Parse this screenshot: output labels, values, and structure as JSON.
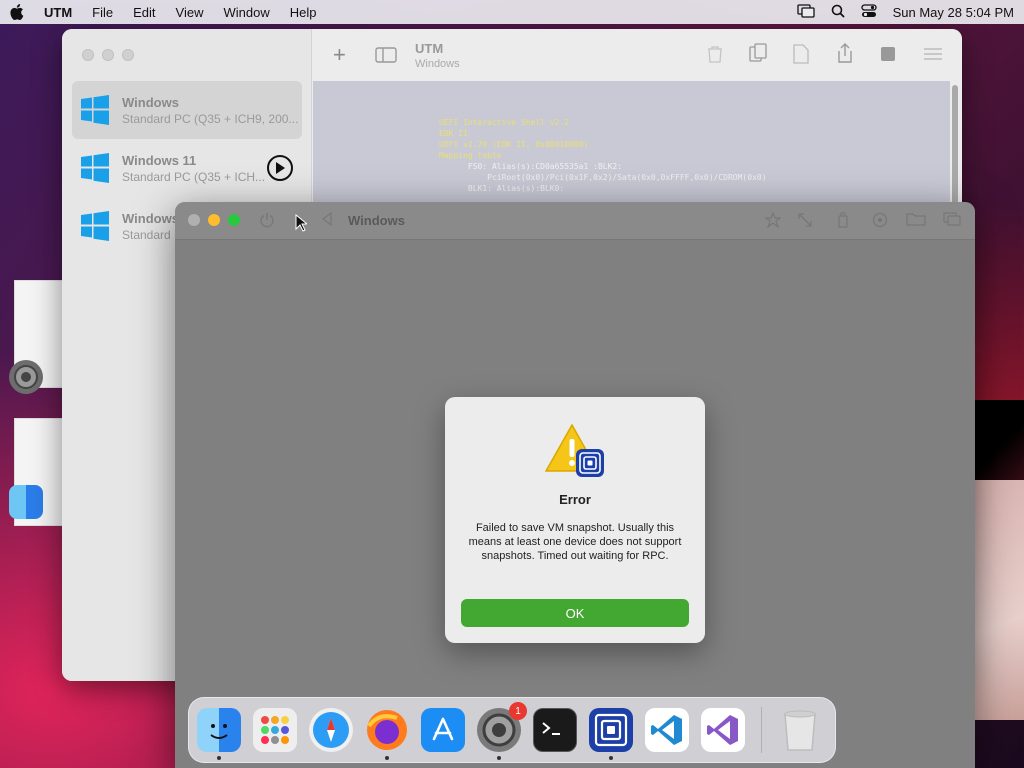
{
  "menubar": {
    "app_name": "UTM",
    "items": [
      "File",
      "Edit",
      "View",
      "Window",
      "Help"
    ],
    "datetime": "Sun May 28  5:04 PM"
  },
  "utm": {
    "title": "UTM",
    "subtitle": "Windows",
    "vms": [
      {
        "name": "Windows",
        "desc": "Standard PC (Q35 + ICH9, 200..."
      },
      {
        "name": "Windows 11",
        "desc": "Standard PC (Q35 + ICH..."
      },
      {
        "name": "Windows",
        "desc": "Standard P"
      }
    ],
    "console_lines": [
      "UEFI Interactive Shell v2.2",
      "EDK II",
      "UEFI v2.70 (EDK II, 0x00010000)",
      "Mapping table",
      "      FS0: Alias(s):CD0a65535a1 :BLK2:",
      "          PciRoot(0x0)/Pci(0x1F,0x2)/Sata(0x0,0xFFFF,0x0)/CDROM(0x0)",
      "      BLK1: Alias(s):BLK0:"
    ]
  },
  "vm_window": {
    "title": "Windows"
  },
  "dialog": {
    "title": "Error",
    "message": "Failed to save VM snapshot. Usually this means at least one device does not support snapshots. Timed out waiting for RPC.",
    "ok_label": "OK"
  },
  "dock": {
    "settings_badge": "1",
    "apps": [
      "finder-icon",
      "launchpad-icon",
      "safari-icon",
      "firefox-icon",
      "app-store-icon",
      "system-settings-icon",
      "terminal-icon",
      "utm-icon",
      "vscode-icon",
      "visual-studio-icon",
      "trash-icon"
    ]
  }
}
